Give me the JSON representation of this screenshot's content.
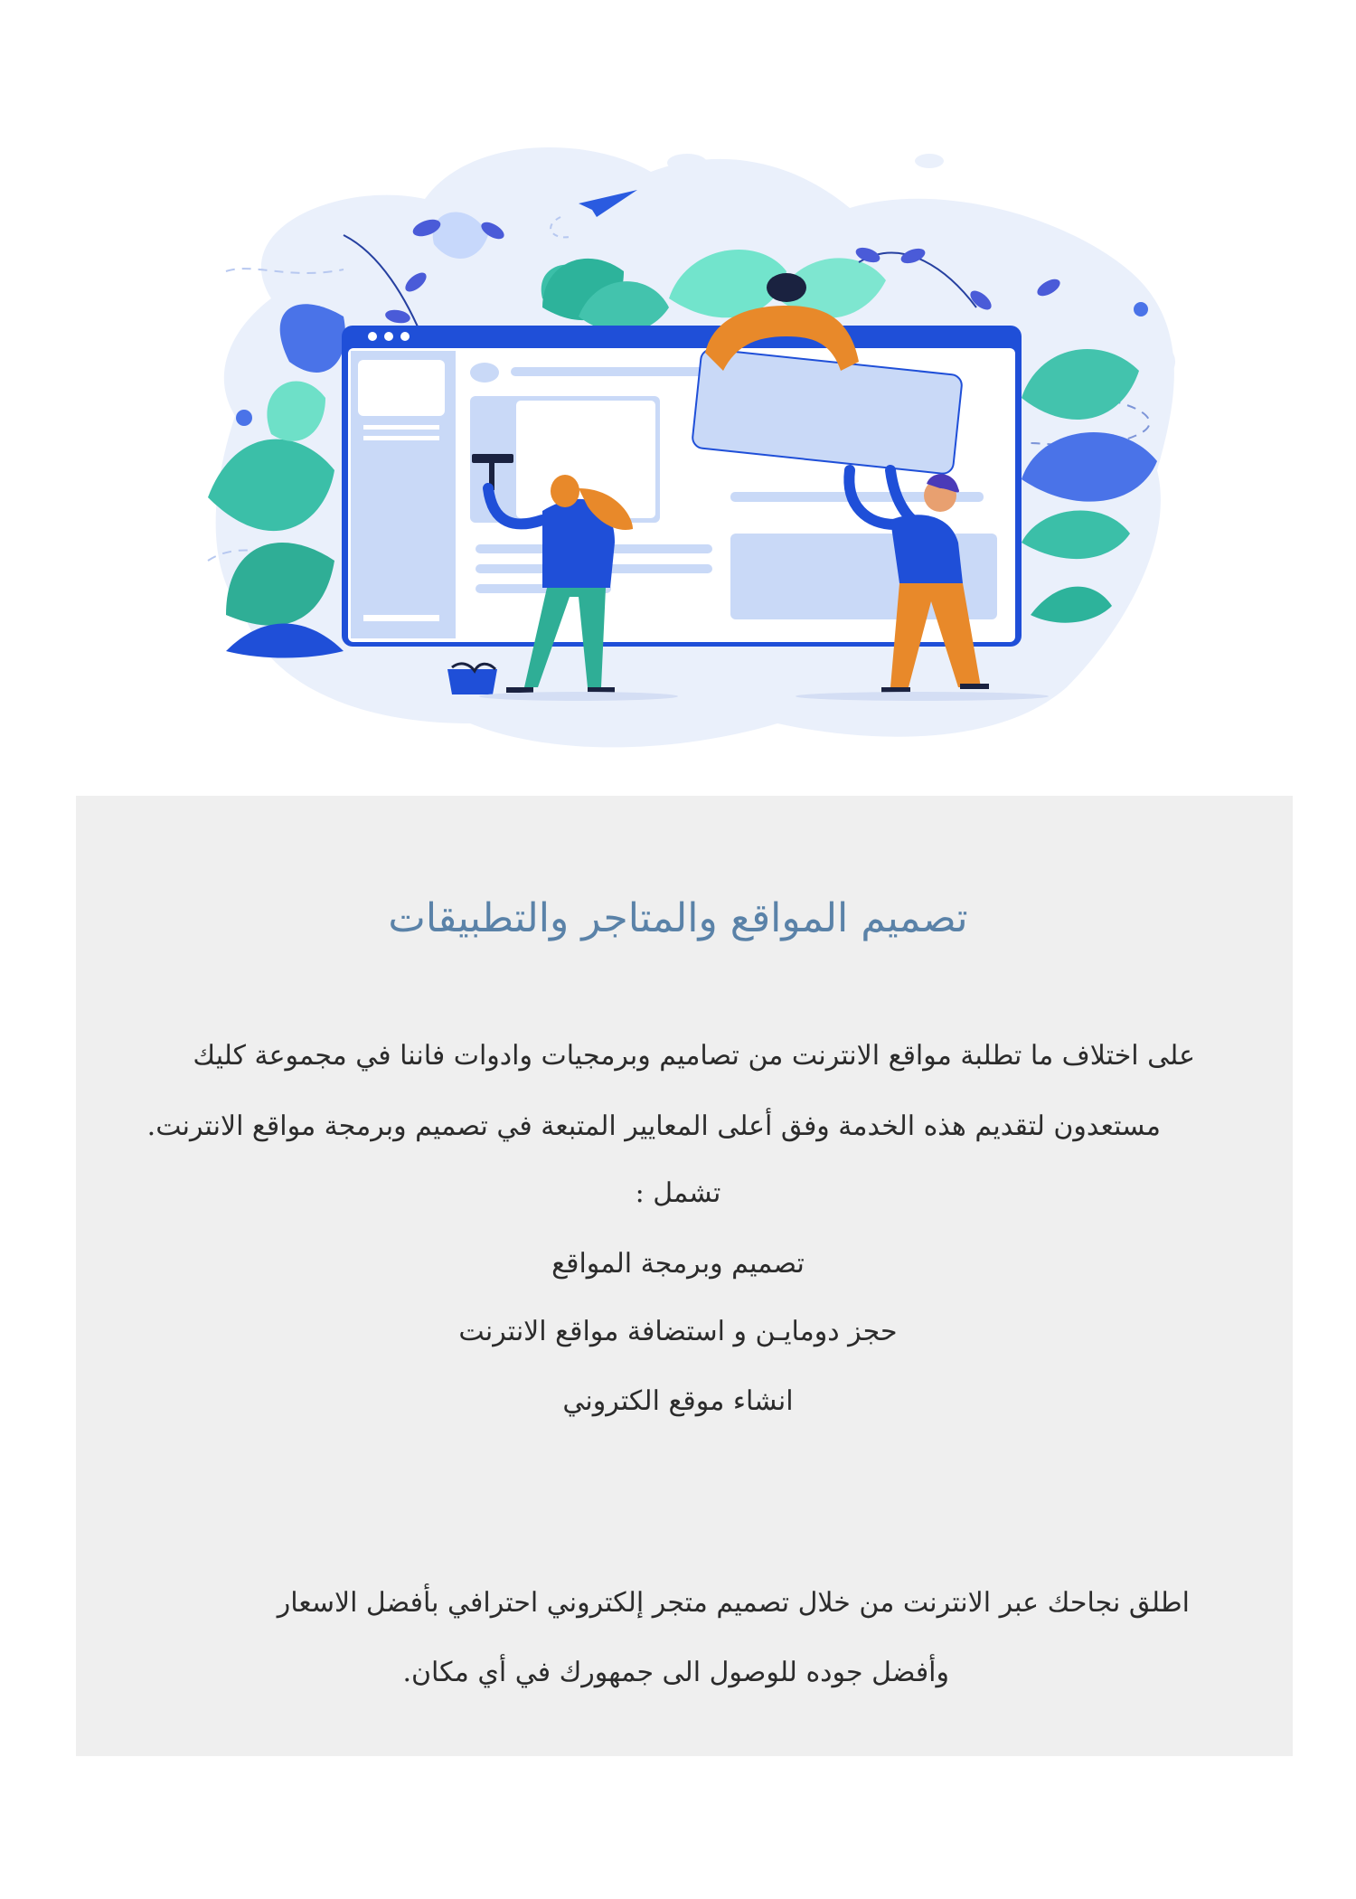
{
  "illustration": {
    "name": "website-design-team-illustration",
    "colors": {
      "primary_blue": "#1f4fd8",
      "light_blue": "#c9d9f7",
      "teal": "#3bbfa8",
      "orange": "#e8892a",
      "blob": "#eaf0fb"
    }
  },
  "panel": {
    "background": "#efefef",
    "title": "تصميم المواقع والمتاجر والتطبيقات",
    "intro_line1": "على اختلاف ما تطلبة مواقع الانترنت من تصاميم وبرمجيات وادوات فاننا في مجموعة كليك",
    "intro_line2": "مستعدون لتقديم هذه الخدمة وفق أعلى المعايير المتبعة في تصميم وبرمجة مواقع الانترنت.",
    "includes_label": "تشمل :",
    "services": [
      "تصميم وبرمجة المواقع",
      "حجز دومايـن و استضافة مواقع الانترنت",
      "انشاء موقع الكتروني"
    ],
    "closing_line1": "اطلق نجاحك عبر الانترنت من خلال تصميم متجر إلكتروني احترافي بأفضل الاسعار",
    "closing_line2": "وأفضل جوده للوصول الى جمهورك في أي مكان."
  }
}
